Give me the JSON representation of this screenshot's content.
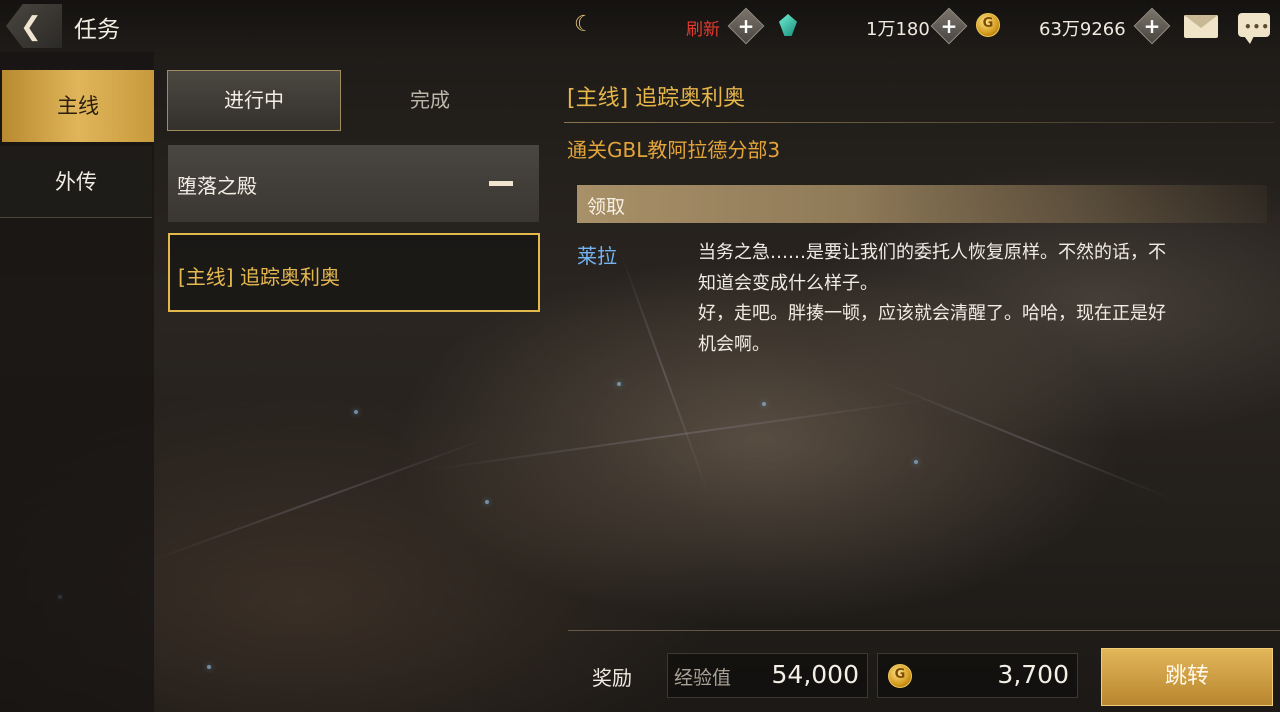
{
  "header": {
    "back_icon": "back-arrow-icon",
    "title": "任务",
    "refresh_label": "刷新",
    "currency_gem": "1万180",
    "currency_gold": "63万9266",
    "icons": [
      "moon-icon",
      "gem-icon",
      "gold-coin-icon",
      "mail-icon",
      "chat-icon"
    ]
  },
  "sidebar": {
    "items": [
      {
        "label": "主线",
        "active": true
      },
      {
        "label": "外传",
        "active": false
      }
    ]
  },
  "list": {
    "tabs": [
      {
        "label": "进行中",
        "active": true
      },
      {
        "label": "完成",
        "active": false
      }
    ],
    "group_label": "堕落之殿",
    "quest_label": "[主线] 追踪奥利奥"
  },
  "detail": {
    "title": "[主线] 追踪奥利奥",
    "objective": "通关GBL教阿拉德分部3",
    "claim_label": "领取",
    "speaker": "莱拉",
    "dialogue": "当务之急……是要让我们的委托人恢复原样。不然的话，不知道会变成什么样子。\n好，走吧。胖揍一顿，应该就会清醒了。哈哈，现在正是好机会啊。"
  },
  "rewards": {
    "label": "奖励",
    "exp_label": "经验值",
    "exp_value": "54,000",
    "gold_value": "3,700",
    "jump_label": "跳转"
  },
  "colors": {
    "accent_gold": "#e3b84a",
    "speaker_blue": "#74b4f0",
    "objective_orange": "#e3a43a",
    "refresh_red": "#e23a2e"
  }
}
